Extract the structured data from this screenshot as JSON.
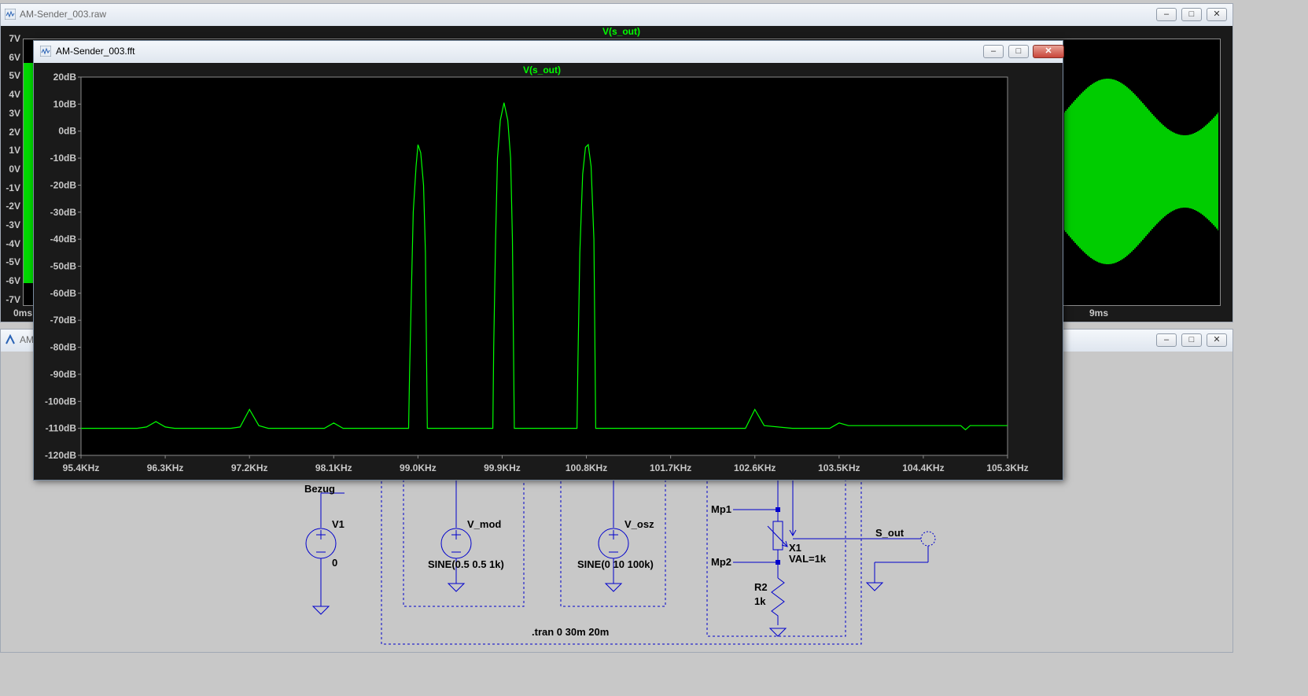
{
  "raw_window": {
    "title": "AM-Sender_003.raw",
    "trace_label": "V(s_out)",
    "y_ticks": [
      "7V",
      "6V",
      "5V",
      "4V",
      "3V",
      "2V",
      "1V",
      "0V",
      "-1V",
      "-2V",
      "-3V",
      "-4V",
      "-5V",
      "-6V",
      "-7V"
    ],
    "x_ticks": [
      "0ms",
      "9ms"
    ]
  },
  "schematic_window": {
    "title_partial": "AM-"
  },
  "fft_window": {
    "title": "AM-Sender_003.fft",
    "trace_label": "V(s_out)"
  },
  "schematic": {
    "bezug": "Bezug",
    "v1_name": "V1",
    "v1_value": "0",
    "vmod_name": "V_mod",
    "vmod_value": "SINE(0.5 0.5 1k)",
    "vosz_name": "V_osz",
    "vosz_value": "SINE(0 10 100k)",
    "mp1": "Mp1",
    "mp2": "Mp2",
    "x1_name": "X1",
    "x1_value": "VAL=1k",
    "r2_name": "R2",
    "r2_value": "1k",
    "sout": "S_out",
    "tran": ".tran 0 30m 20m"
  },
  "chart_data": {
    "type": "line",
    "title": "V(s_out)",
    "xlabel": "",
    "ylabel": "",
    "x_tick_labels": [
      "95.4KHz",
      "96.3KHz",
      "97.2KHz",
      "98.1KHz",
      "99.0KHz",
      "99.9KHz",
      "100.8KHz",
      "101.7KHz",
      "102.6KHz",
      "103.5KHz",
      "104.4KHz",
      "105.3KHz"
    ],
    "y_tick_labels": [
      "20dB",
      "10dB",
      "0dB",
      "-10dB",
      "-20dB",
      "-30dB",
      "-40dB",
      "-50dB",
      "-60dB",
      "-70dB",
      "-80dB",
      "-90dB",
      "-100dB",
      "-110dB",
      "-120dB"
    ],
    "xlim": [
      95.4,
      105.3
    ],
    "ylim": [
      -120,
      20
    ],
    "x_unit": "KHz",
    "y_unit": "dB",
    "series": [
      {
        "color": "#00ff00",
        "points": [
          [
            95.4,
            -110
          ],
          [
            96.0,
            -110
          ],
          [
            96.1,
            -109.5
          ],
          [
            96.2,
            -107.5
          ],
          [
            96.3,
            -109.5
          ],
          [
            96.4,
            -110
          ],
          [
            97.0,
            -110
          ],
          [
            97.1,
            -109.5
          ],
          [
            97.2,
            -103
          ],
          [
            97.3,
            -109
          ],
          [
            97.4,
            -110
          ],
          [
            98.0,
            -110
          ],
          [
            98.1,
            -108
          ],
          [
            98.2,
            -110
          ],
          [
            98.9,
            -110
          ],
          [
            98.91,
            -90
          ],
          [
            98.93,
            -60
          ],
          [
            98.95,
            -30
          ],
          [
            98.98,
            -13
          ],
          [
            99.0,
            -5
          ],
          [
            99.03,
            -8
          ],
          [
            99.06,
            -20
          ],
          [
            99.08,
            -45
          ],
          [
            99.1,
            -110
          ],
          [
            99.8,
            -110
          ],
          [
            99.81,
            -80
          ],
          [
            99.83,
            -40
          ],
          [
            99.85,
            -10
          ],
          [
            99.88,
            4
          ],
          [
            99.92,
            10.5
          ],
          [
            99.96,
            4
          ],
          [
            99.99,
            -10
          ],
          [
            100.01,
            -40
          ],
          [
            100.03,
            -110
          ],
          [
            100.7,
            -110
          ],
          [
            100.71,
            -85
          ],
          [
            100.73,
            -45
          ],
          [
            100.76,
            -16
          ],
          [
            100.79,
            -6
          ],
          [
            100.82,
            -5
          ],
          [
            100.85,
            -13
          ],
          [
            100.88,
            -40
          ],
          [
            100.9,
            -110
          ],
          [
            101.5,
            -110
          ],
          [
            102.4,
            -110
          ],
          [
            102.5,
            -110
          ],
          [
            102.6,
            -103
          ],
          [
            102.7,
            -109
          ],
          [
            103.0,
            -110
          ],
          [
            103.4,
            -110
          ],
          [
            103.5,
            -108
          ],
          [
            103.6,
            -109
          ],
          [
            104.3,
            -109
          ],
          [
            104.4,
            -109
          ],
          [
            104.8,
            -109
          ],
          [
            104.85,
            -110.5
          ],
          [
            104.9,
            -109
          ],
          [
            105.0,
            -109
          ],
          [
            105.3,
            -109
          ]
        ]
      }
    ],
    "grid": false,
    "legend": "none"
  },
  "colors": {
    "trace": "#00ff00",
    "plot_bg": "#000000",
    "schematic_bg": "#c8c8c8",
    "wire": "#0000cd"
  }
}
